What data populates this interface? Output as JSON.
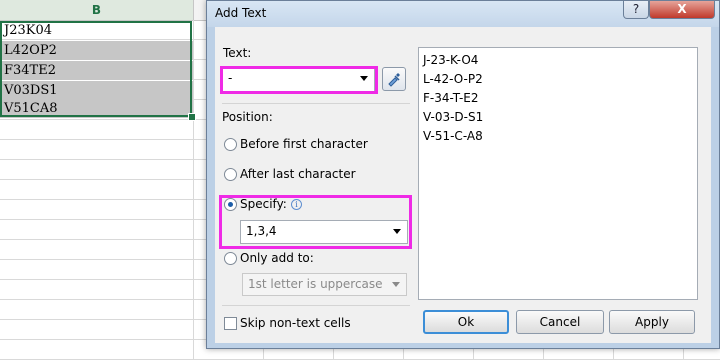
{
  "spreadsheet": {
    "column_header": "B",
    "cells": [
      "J23K04",
      "L42OP2",
      "F34TE2",
      "V03DS1",
      "V51CA8"
    ]
  },
  "dialog": {
    "title": "Add Text",
    "help_label": "?",
    "close_label": "X",
    "text_label": "Text:",
    "text_value": "-",
    "position_label": "Position:",
    "options": {
      "before_first": "Before first character",
      "after_last": "After last character",
      "specify": "Specify:",
      "only_add_to": "Only add to:"
    },
    "selected_option": "specify",
    "specify_value": "1,3,4",
    "only_add_to_value": "1st letter is uppercase",
    "skip_non_text": "Skip non-text cells",
    "skip_non_text_checked": false,
    "preview_lines": [
      "J-23-K-O4",
      "L-42-O-P2",
      "F-34-T-E2",
      "V-03-D-S1",
      "V-51-C-A8"
    ],
    "buttons": {
      "ok": "Ok",
      "cancel": "Cancel",
      "apply": "Apply"
    }
  },
  "colors": {
    "highlight": "#ef2ae6",
    "excel_green": "#217346",
    "selection_gray": "#c6c6c6",
    "dialog_frame": "#bcd0e6"
  }
}
